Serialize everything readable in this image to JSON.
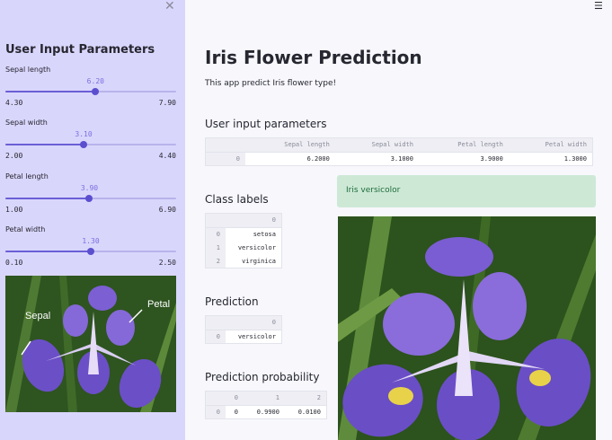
{
  "sidebar": {
    "close_icon": "close-icon",
    "title": "User Input Parameters",
    "sliders": [
      {
        "label": "Sepal length",
        "value": "6.20",
        "min": "4.30",
        "max": "7.90",
        "fraction": 0.528
      },
      {
        "label": "Sepal width",
        "value": "3.10",
        "min": "2.00",
        "max": "4.40",
        "fraction": 0.458
      },
      {
        "label": "Petal length",
        "value": "3.90",
        "min": "1.00",
        "max": "6.90",
        "fraction": 0.492
      },
      {
        "label": "Petal width",
        "value": "1.30",
        "min": "0.10",
        "max": "2.50",
        "fraction": 0.5
      }
    ],
    "image": {
      "label_sepal": "Sepal",
      "label_petal": "Petal"
    }
  },
  "header": {
    "menu_icon": "hamburger-menu-icon"
  },
  "main": {
    "title": "Iris Flower Prediction",
    "subtitle": "This app predict Iris flower type!",
    "input_heading": "User input parameters",
    "input_table": {
      "columns": [
        "",
        "Sepal length",
        "Sepal width",
        "Petal length",
        "Petal width"
      ],
      "rows": [
        [
          "0",
          "6.2000",
          "3.1000",
          "3.9000",
          "1.3000"
        ]
      ]
    },
    "class_heading": "Class labels",
    "class_table": {
      "columns": [
        "",
        "0"
      ],
      "rows": [
        [
          "0",
          "setosa"
        ],
        [
          "1",
          "versicolor"
        ],
        [
          "2",
          "virginica"
        ]
      ]
    },
    "prediction_heading": "Prediction",
    "prediction_table": {
      "columns": [
        "",
        "0"
      ],
      "rows": [
        [
          "0",
          "versicolor"
        ]
      ]
    },
    "probability_heading": "Prediction probability",
    "probability_table": {
      "columns": [
        "",
        "0",
        "1",
        "2"
      ],
      "rows": [
        [
          "0",
          "0",
          "0.9900",
          "0.0100"
        ]
      ]
    },
    "result_text": "Iris versicolor",
    "colors": {
      "accent": "#6a5fd6",
      "sidebar_bg": "#d9d6fc",
      "success_bg": "#cde9d6",
      "success_text": "#1f6b3a"
    }
  }
}
